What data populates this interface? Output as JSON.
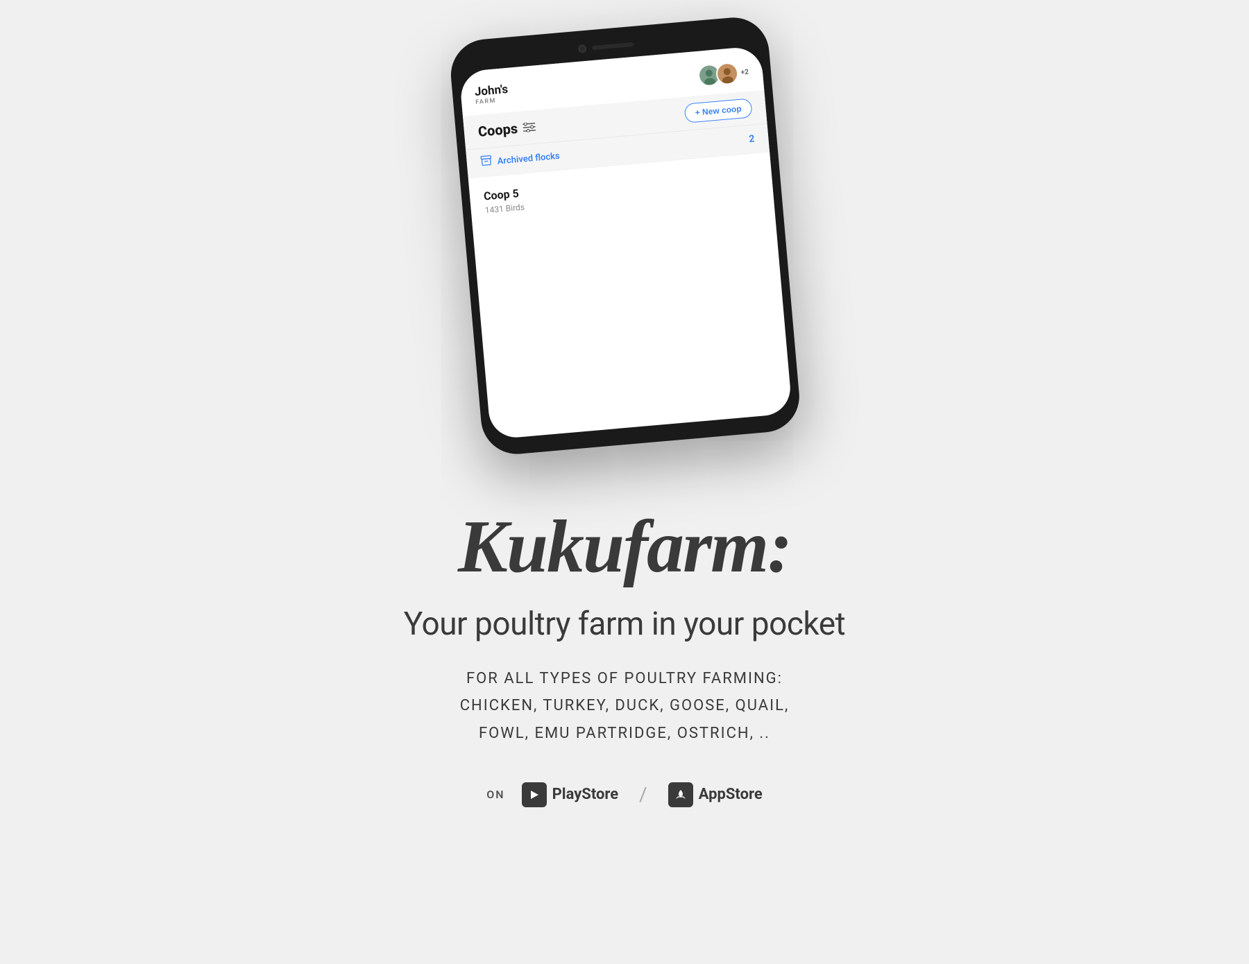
{
  "background_color": "#f0f0f0",
  "phone": {
    "farm": {
      "name": "John's",
      "label": "FARM"
    },
    "avatars": {
      "count_extra": "+2"
    },
    "coops_section": {
      "title": "Coops",
      "new_coop_label": "+ New coop"
    },
    "archived": {
      "text": "Archived flocks",
      "count": "2"
    },
    "coop_card": {
      "name": "Coop 5",
      "birds": "1431 Birds"
    }
  },
  "content": {
    "app_name": "Kukufarm:",
    "tagline": "Your poultry farm in your pocket",
    "poultry_line1": "FOR ALL TYPES OF POULTRY FARMING:",
    "poultry_line2": "CHICKEN, TURKEY, DUCK, GOOSE, QUAIL,",
    "poultry_line3": "FOWL, EMU PARTRIDGE, OSTRICH, ..",
    "store_on": "ON",
    "store_separator": "/",
    "playstore_label": "PlayStore",
    "appstore_label": "AppStore"
  }
}
